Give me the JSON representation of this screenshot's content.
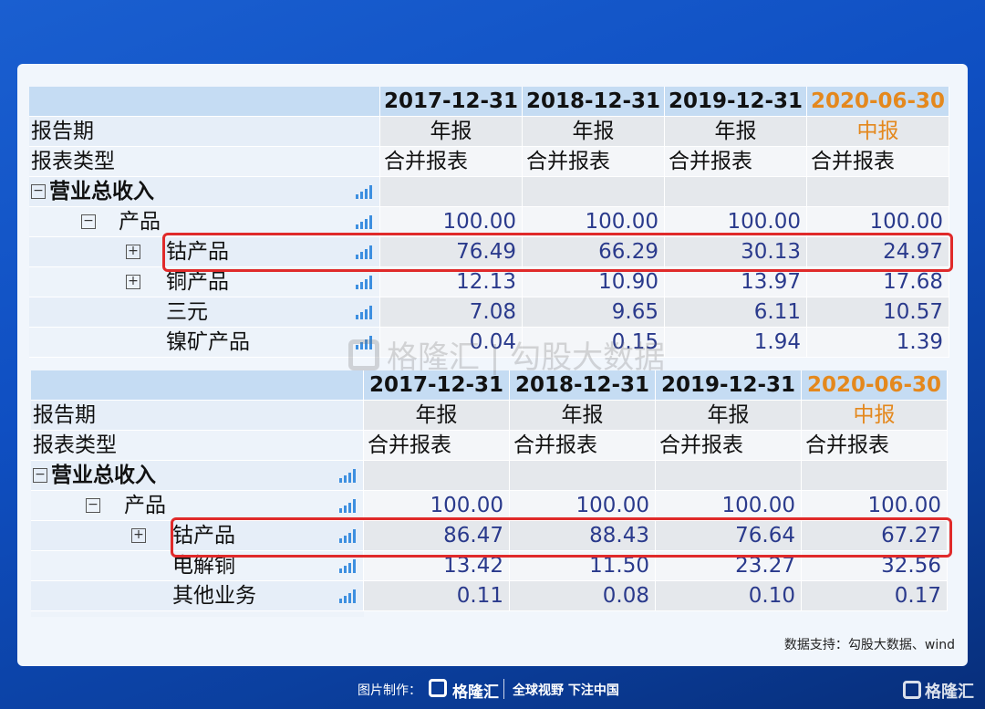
{
  "table1": {
    "dates": [
      "2017-12-31",
      "2018-12-31",
      "2019-12-31",
      "2020-06-30"
    ],
    "period_label": "报告期",
    "periods": [
      "年报",
      "年报",
      "年报",
      "中报"
    ],
    "type_label": "报表类型",
    "types": [
      "合并报表",
      "合并报表",
      "合并报表",
      "合并报表"
    ],
    "rows": [
      {
        "label": "营业总收入",
        "values": [
          "",
          "",
          "",
          ""
        ]
      },
      {
        "label": "产品",
        "values": [
          "100.00",
          "100.00",
          "100.00",
          "100.00"
        ]
      },
      {
        "label": "钴产品",
        "values": [
          "76.49",
          "66.29",
          "30.13",
          "24.97"
        ]
      },
      {
        "label": "铜产品",
        "values": [
          "12.13",
          "10.90",
          "13.97",
          "17.68"
        ]
      },
      {
        "label": "三元",
        "values": [
          "7.08",
          "9.65",
          "6.11",
          "10.57"
        ]
      },
      {
        "label": "镍矿产品",
        "values": [
          "0.04",
          "0.15",
          "1.94",
          "1.39"
        ]
      }
    ]
  },
  "table2": {
    "dates": [
      "2017-12-31",
      "2018-12-31",
      "2019-12-31",
      "2020-06-30"
    ],
    "period_label": "报告期",
    "periods": [
      "年报",
      "年报",
      "年报",
      "中报"
    ],
    "type_label": "报表类型",
    "types": [
      "合并报表",
      "合并报表",
      "合并报表",
      "合并报表"
    ],
    "rows": [
      {
        "label": "营业总收入",
        "values": [
          "",
          "",
          "",
          ""
        ]
      },
      {
        "label": "产品",
        "values": [
          "100.00",
          "100.00",
          "100.00",
          "100.00"
        ]
      },
      {
        "label": "钴产品",
        "values": [
          "86.47",
          "88.43",
          "76.64",
          "67.27"
        ]
      },
      {
        "label": "电解铜",
        "values": [
          "13.42",
          "11.50",
          "23.27",
          "32.56"
        ]
      },
      {
        "label": "其他业务",
        "values": [
          "0.11",
          "0.08",
          "0.10",
          "0.17"
        ]
      }
    ]
  },
  "watermark": "格隆汇 | 勾股大数据",
  "source": "数据支持：勾股大数据、wind",
  "footer": {
    "made_by": "图片制作：",
    "brand": "格隆汇",
    "slogan": "全球视野 下注中国"
  },
  "corner_brand": "格隆汇",
  "colors": {
    "accent_orange": "#e4881d",
    "highlight_red": "#e02a2a",
    "value_blue": "#2a3a8c"
  }
}
